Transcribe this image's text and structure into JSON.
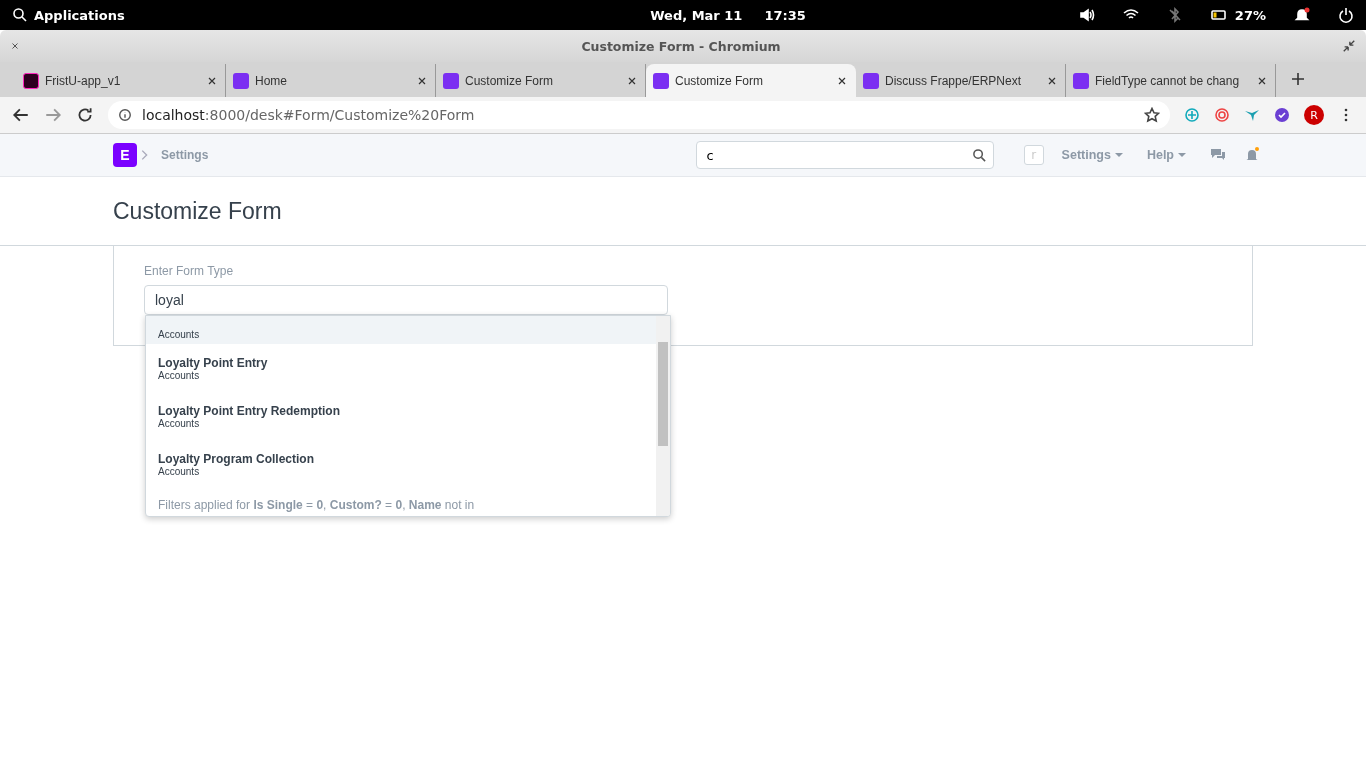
{
  "system_bar": {
    "applications": "Applications",
    "date": "Wed, Mar 11",
    "time": "17:35",
    "battery": "27%"
  },
  "window": {
    "title": "Customize Form - Chromium"
  },
  "tabs": [
    {
      "label": "FristU-app_v1",
      "kind": "xd",
      "selected": false
    },
    {
      "label": "Home",
      "kind": "e",
      "selected": false
    },
    {
      "label": "Customize Form",
      "kind": "e",
      "selected": false
    },
    {
      "label": "Customize Form",
      "kind": "e",
      "selected": true
    },
    {
      "label": "Discuss Frappe/ERPNext",
      "kind": "e",
      "selected": false
    },
    {
      "label": "FieldType cannot be chang",
      "kind": "e",
      "selected": false
    }
  ],
  "address": {
    "host": "localhost",
    "path": ":8000/desk#Form/Customize%20Form"
  },
  "profile_initial": "R",
  "app_logo": "E",
  "navbar": {
    "breadcrumb": "Settings",
    "search_value": "c",
    "avatar": "r",
    "menus": [
      "Settings",
      "Help"
    ]
  },
  "page": {
    "title": "Customize Form"
  },
  "form": {
    "label": "Enter Form Type",
    "value": "loyal",
    "suggestions": [
      {
        "module": "Accounts",
        "selected": true
      },
      {
        "title": "Loyalty Point Entry",
        "module": "Accounts",
        "selected": false
      },
      {
        "title": "Loyalty Point Entry Redemption",
        "module": "Accounts",
        "selected": false
      },
      {
        "title": "Loyalty Program Collection",
        "module": "Accounts",
        "selected": false
      }
    ],
    "filter_note": "Filters applied for **Is Single** = **0**, **Custom?** = **0**, **Name** not in"
  }
}
